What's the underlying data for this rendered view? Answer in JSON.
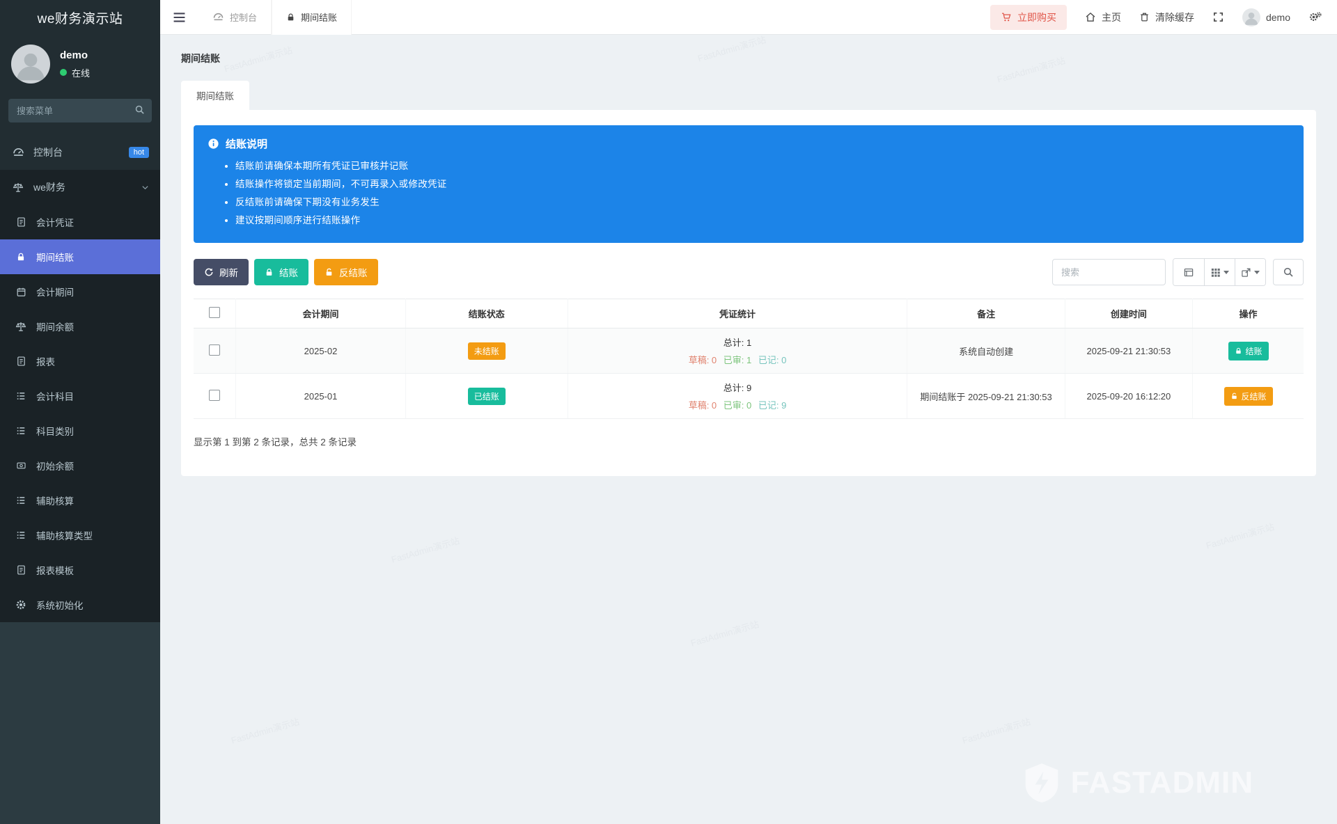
{
  "app": {
    "title": "we财务演示站"
  },
  "topbar": {
    "tabs": [
      {
        "label": "控制台"
      },
      {
        "label": "期间结账"
      }
    ],
    "buy_label": "立即购买",
    "home_label": "主页",
    "clear_cache_label": "清除缓存",
    "username": "demo"
  },
  "sidebar": {
    "user": {
      "name": "demo",
      "status": "在线"
    },
    "search_placeholder": "搜索菜单",
    "items": [
      {
        "label": "控制台",
        "badge": "hot"
      },
      {
        "label": "we财务"
      },
      {
        "label": "会计凭证"
      },
      {
        "label": "期间结账"
      },
      {
        "label": "会计期间"
      },
      {
        "label": "期间余额"
      },
      {
        "label": "报表"
      },
      {
        "label": "会计科目"
      },
      {
        "label": "科目类别"
      },
      {
        "label": "初始余额"
      },
      {
        "label": "辅助核算"
      },
      {
        "label": "辅助核算类型"
      },
      {
        "label": "报表模板"
      },
      {
        "label": "系统初始化"
      }
    ]
  },
  "page": {
    "title": "期间结账",
    "tab": "期间结账",
    "notice": {
      "title": "结账说明",
      "items": [
        "结账前请确保本期所有凭证已审核并记账",
        "结账操作将锁定当前期间，不可再录入或修改凭证",
        "反结账前请确保下期没有业务发生",
        "建议按期间顺序进行结账操作"
      ]
    },
    "toolbar": {
      "refresh_label": "刷新",
      "close_label": "结账",
      "reopen_label": "反结账",
      "search_placeholder": "搜索"
    },
    "table": {
      "columns": [
        "会计期间",
        "结账状态",
        "凭证统计",
        "备注",
        "创建时间",
        "操作"
      ],
      "rows": [
        {
          "period": "2025-02",
          "status": "未结账",
          "total": "总计: 1",
          "draft": "草稿: 0",
          "audited": "已审: 1",
          "booked": "已记: 0",
          "remark": "系统自动创建",
          "created": "2025-09-21 21:30:53",
          "action": "结账"
        },
        {
          "period": "2025-01",
          "status": "已结账",
          "total": "总计: 9",
          "draft": "草稿: 0",
          "audited": "已审: 0",
          "booked": "已记: 9",
          "remark": "期间结账于 2025-09-21 21:30:53",
          "created": "2025-09-20 16:12:20",
          "action": "反结账"
        }
      ],
      "summary": "显示第 1 到第 2 条记录，总共 2 条记录"
    }
  },
  "watermark": {
    "text": "FastAdmin演示站",
    "logo": "FASTADMIN"
  },
  "colors": {
    "sidebar_bg": "#222d32",
    "active_item": "#5b6fd8",
    "notice_blue": "#1c84e8",
    "success": "#18bc9c",
    "warning": "#f39c12",
    "danger": "#e05548",
    "dark_button": "#454d66",
    "stat_draft": "#e0836f",
    "stat_audited": "#7cc47c",
    "stat_booked": "#76c4bd"
  }
}
